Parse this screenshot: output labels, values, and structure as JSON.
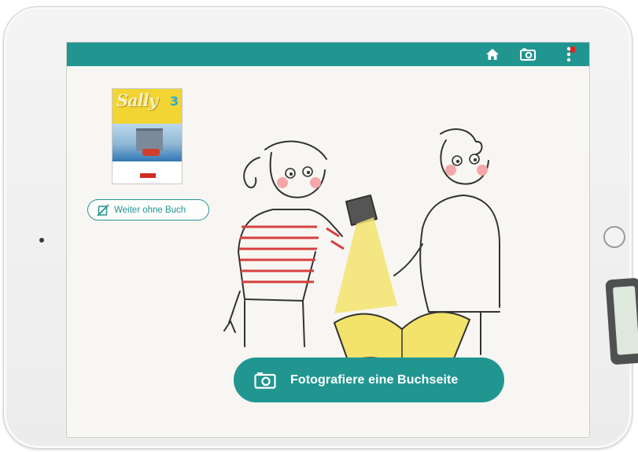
{
  "toolbar": {
    "home_icon": "home-icon",
    "camera_icon": "camera-icon",
    "menu_icon": "more-vertical-icon",
    "notification_color": "#e1251b"
  },
  "book": {
    "title": "Sally",
    "volume": "3"
  },
  "actions": {
    "no_book_label": "Weiter ohne Buch",
    "no_book_icon": "book-crossed-icon",
    "photo_label": "Fotografiere eine Buchseite",
    "photo_icon": "camera-icon"
  },
  "colors": {
    "accent": "#219691",
    "background": "#f7f6f3",
    "highlight": "#f3e36b"
  }
}
